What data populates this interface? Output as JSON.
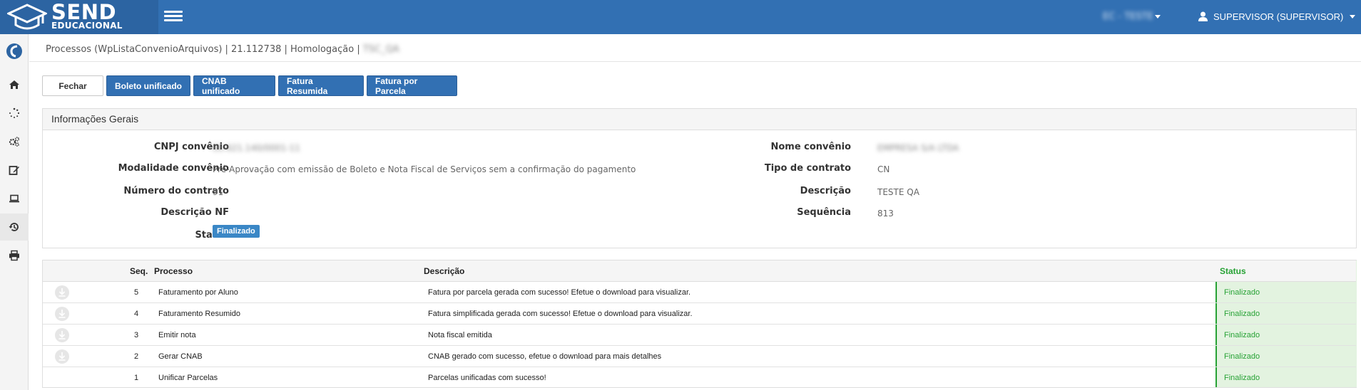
{
  "topbar": {
    "logo_main": "SEND",
    "logo_sub": "EDUCACIONAL",
    "tenant": "EC - TESTE",
    "user": "SUPERVISOR (SUPERVISOR)"
  },
  "breadcrumb": {
    "text": "Processos (WpListaConvenioArquivos) | 21.112738 | Homologação |",
    "blurred": "TSC_QA"
  },
  "buttons": {
    "fechar": "Fechar",
    "boleto": "Boleto unificado",
    "cnab": "CNAB unificado",
    "fatura_resumida": "Fatura Resumida",
    "fatura_parcela": "Fatura por Parcela"
  },
  "panel": {
    "title": "Informações Gerais",
    "left": [
      {
        "label": "CNPJ convênio",
        "value": "00.621.140/0001-11",
        "blurred": true
      },
      {
        "label": "Modalidade convênio",
        "value": "Pré-Aprovação com emissão de Boleto e Nota Fiscal de Serviços sem a confirmação do pagamento"
      },
      {
        "label": "Número do contrato",
        "value": "91"
      },
      {
        "label": "Descrição NF",
        "value": ""
      },
      {
        "label": "Status",
        "badge": "Finalizado"
      }
    ],
    "right": [
      {
        "label": "Nome convênio",
        "value": "EMPRESA S/A LTDA",
        "blurred": true
      },
      {
        "label": "Tipo de contrato",
        "value": "CN"
      },
      {
        "label": "Descrição",
        "value": "TESTE QA"
      },
      {
        "label": "Sequência",
        "value": "813"
      }
    ]
  },
  "table": {
    "headers": {
      "seq": "Seq.",
      "processo": "Processo",
      "descricao": "Descrição",
      "status": "Status"
    },
    "rows": [
      {
        "seq": "5",
        "processo": "Faturamento por Aluno",
        "descricao": "Fatura por parcela gerada com sucesso! Efetue o download para visualizar.",
        "status": "Finalizado",
        "download": true
      },
      {
        "seq": "4",
        "processo": "Faturamento Resumido",
        "descricao": "Fatura simplificada gerada com sucesso! Efetue o download para visualizar.",
        "status": "Finalizado",
        "download": true
      },
      {
        "seq": "3",
        "processo": "Emitir nota",
        "descricao": "Nota fiscal emitida",
        "status": "Finalizado",
        "download": true
      },
      {
        "seq": "2",
        "processo": "Gerar CNAB",
        "descricao": "CNAB gerado com sucesso, efetue o download para mais detalhes",
        "status": "Finalizado",
        "download": true
      },
      {
        "seq": "1",
        "processo": "Unificar Parcelas",
        "descricao": "Parcelas unificadas com sucesso!",
        "status": "Finalizado",
        "download": false
      }
    ]
  },
  "colors": {
    "primary": "#3270b3",
    "success": "#27a235",
    "badge": "#3a87c6"
  }
}
